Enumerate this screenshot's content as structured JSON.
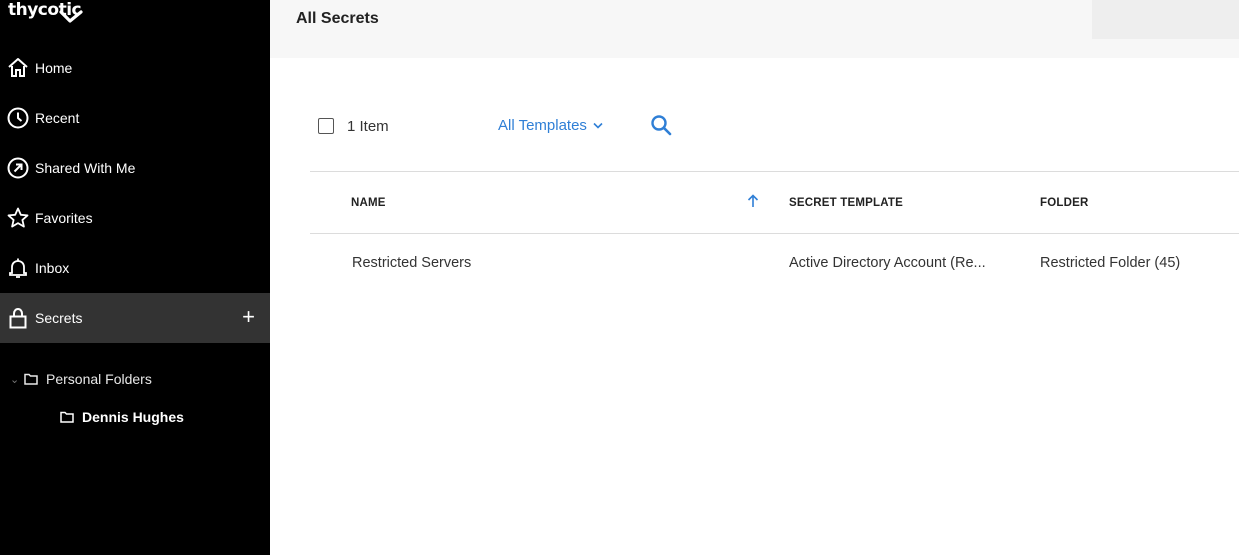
{
  "brand": {
    "logo_text": "thycotic"
  },
  "sidebar": {
    "items": [
      {
        "label": "Home",
        "icon": "home-icon"
      },
      {
        "label": "Recent",
        "icon": "clock-icon"
      },
      {
        "label": "Shared With Me",
        "icon": "shared-icon"
      },
      {
        "label": "Favorites",
        "icon": "star-icon"
      },
      {
        "label": "Inbox",
        "icon": "bell-icon"
      },
      {
        "label": "Secrets",
        "icon": "lock-icon",
        "active": true,
        "action": "+"
      }
    ],
    "tree": {
      "root": {
        "label": "Personal Folders",
        "icon": "folder-icon"
      },
      "children": [
        {
          "label": "Dennis Hughes",
          "icon": "folder-icon"
        }
      ]
    }
  },
  "header": {
    "title": "All Secrets"
  },
  "toolbar": {
    "item_count": "1 Item",
    "template_filter": "All Templates",
    "search_icon": "search-icon"
  },
  "table": {
    "columns": [
      "NAME",
      "SECRET TEMPLATE",
      "FOLDER"
    ],
    "sort": {
      "column": "NAME",
      "direction": "ascending"
    },
    "rows": [
      {
        "name": "Restricted Servers",
        "template": "Active Directory Account (Re...",
        "folder": "Restricted Folder (45)"
      }
    ]
  },
  "colors": {
    "sidebar_bg": "#000000",
    "sidebar_active": "#333333",
    "accent_blue": "#2f7fd6",
    "header_bg": "#f7f7f7"
  }
}
